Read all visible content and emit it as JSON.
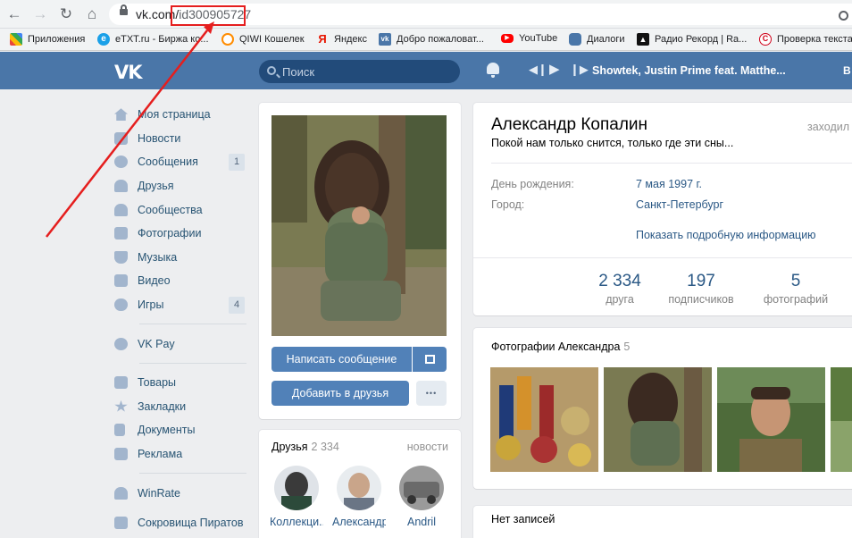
{
  "browser": {
    "url_host": "vk.com/",
    "url_path": "id300905727",
    "bookmarks": [
      {
        "label": "Приложения",
        "icon": "apps-grid-icon",
        "color": "#e8453c"
      },
      {
        "label": "eTXT.ru - Биржа ко...",
        "icon": "etxt-icon",
        "color": "#1aa0e8"
      },
      {
        "label": "QIWI Кошелек",
        "icon": "qiwi-icon",
        "color": "#ff8c00"
      },
      {
        "label": "Яндекс",
        "icon": "yandex-icon",
        "color": "#e61400"
      },
      {
        "label": "Добро пожаловат...",
        "icon": "vk-icon",
        "color": "#4a76a8"
      },
      {
        "label": "YouTube",
        "icon": "youtube-icon",
        "color": "#ff0000"
      },
      {
        "label": "Диалоги",
        "icon": "chat-icon",
        "color": "#4a76a8"
      },
      {
        "label": "Радио Рекорд | Ra...",
        "icon": "radio-record-icon",
        "color": "#111111"
      },
      {
        "label": "Проверка текста",
        "icon": "copyright-icon",
        "color": "#d0021b"
      }
    ]
  },
  "header": {
    "logo": "VK",
    "search_placeholder": "Поиск",
    "track": "Showtek, Justin Prime feat. Matthe...",
    "edge_text": "В"
  },
  "sidebar": {
    "items": [
      {
        "label": "Моя страница",
        "icon": "home-icon"
      },
      {
        "label": "Новости",
        "icon": "news-icon"
      },
      {
        "label": "Сообщения",
        "icon": "messages-icon",
        "badge": "1"
      },
      {
        "label": "Друзья",
        "icon": "friends-icon"
      },
      {
        "label": "Сообщества",
        "icon": "communities-icon"
      },
      {
        "label": "Фотографии",
        "icon": "camera-icon"
      },
      {
        "label": "Музыка",
        "icon": "music-icon"
      },
      {
        "label": "Видео",
        "icon": "video-icon"
      },
      {
        "label": "Игры",
        "icon": "games-icon",
        "badge": "4"
      }
    ],
    "vkpay": "VK Pay",
    "items2": [
      {
        "label": "Товары",
        "icon": "goods-icon"
      },
      {
        "label": "Закладки",
        "icon": "bookmarks-star-icon"
      },
      {
        "label": "Документы",
        "icon": "documents-icon"
      },
      {
        "label": "Реклама",
        "icon": "ads-icon"
      }
    ],
    "winrate": "WinRate",
    "cut_item": "Сокровища Пиратов"
  },
  "profile": {
    "name": "Александр Копалин",
    "status": "Покой нам только снится, только где эти сны...",
    "last_seen": "заходил",
    "birthday_label": "День рождения:",
    "birthday_value": "7 мая 1997 г.",
    "city_label": "Город:",
    "city_value": "Санкт-Петербург",
    "more_info": "Показать подробную информацию",
    "stats": [
      {
        "num": "2 334",
        "label": "друга"
      },
      {
        "num": "197",
        "label": "подписчиков"
      },
      {
        "num": "5",
        "label": "фотографий"
      }
    ]
  },
  "actions": {
    "write_message": "Написать сообщение",
    "add_friend": "Добавить в друзья",
    "more": "•••"
  },
  "friends": {
    "title": "Друзья",
    "count": "2 334",
    "news": "новости",
    "list": [
      "Коллекци...",
      "Александр",
      "Andril"
    ]
  },
  "photos": {
    "title": "Фотографии Александра",
    "count": "5"
  },
  "wall": {
    "no_posts": "Нет записей"
  },
  "colors": {
    "vk_blue": "#4a76a8",
    "link": "#2a5885",
    "button": "#5181b8",
    "annotation_red": "#e51e1e"
  }
}
